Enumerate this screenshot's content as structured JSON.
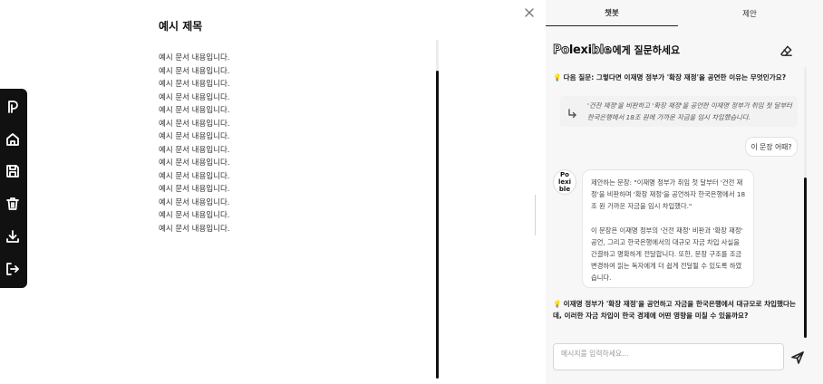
{
  "sidebar": {
    "items": [
      {
        "icon": "logo-p-icon"
      },
      {
        "icon": "home-icon"
      },
      {
        "icon": "save-icon"
      },
      {
        "icon": "trash-icon"
      },
      {
        "icon": "download-icon"
      },
      {
        "icon": "logout-icon"
      }
    ]
  },
  "document": {
    "title": "예시 제목",
    "lines": [
      "예시 문서 내용입니다.",
      "예시 문서 내용입니다.",
      "예시 문서 내용입니다.",
      "예시 문서 내용입니다.",
      "예시 문서 내용입니다.",
      "예시 문서 내용입니다.",
      "예시 문서 내용입니다.",
      "예시 문서 내용입니다.",
      "예시 문서 내용입니다.",
      "예시 문서 내용입니다.",
      "예시 문서 내용입니다.",
      "예시 문서 내용입니다.",
      "예시 문서 내용입니다.",
      "예시 문서 내용입니다."
    ]
  },
  "panel": {
    "tabs": [
      "챗봇",
      "제안"
    ],
    "active_tab": "챗봇",
    "brand": {
      "part1": "Po",
      "part2": "lexi",
      "part3": "ble",
      "suffix": "에게 질문하세요"
    },
    "suggestion_top": "다음 질문: 그렇다면 이재명 정부가 '확장 재정'을 공연한 이유는 무엇인가요?",
    "quote": "'건전 재정'을 비판하고 '확장 재정'을 공언한 이재명 정부가 취임 첫 달부터 한국은행에서 18조 원에 가까운 자금을 임시 차입했습니다.",
    "user_message": "이 문장 어때?",
    "bot_avatar_text": [
      "Po",
      "lexi",
      "ble"
    ],
    "bot_message": [
      "제안하는 문장: \"이재명 정부가 취임 첫 달부터 '건전 재정'을 비판하며 '확장 재정'을 공언하자 한국은행에서 18조 원 가까운 자금을 임시 차입했다.\"",
      "이 문장은 이재명 정부의 '건전 재정' 비판과 '확장 재정' 공언, 그리고 한국은행에서의 대규모 자금 차입 사실을 간결하고 명확하게 전달합니다. 또한, 문장 구조를 조금 변경하여 읽는 독자에게 더 쉽게 전달될 수 있도록 하였습니다."
    ],
    "suggestion_bottom": "이재명 정부가 '확장 재정'을 공언하고 자금을 한국은행에서 대규모로 차입했다는데, 이러한 자금 차입이 한국 경제에 어떤 영향을 미칠 수 있을까요?",
    "input_placeholder": "메시지를 입력하세요...",
    "accent_color": "#e9b21a"
  }
}
